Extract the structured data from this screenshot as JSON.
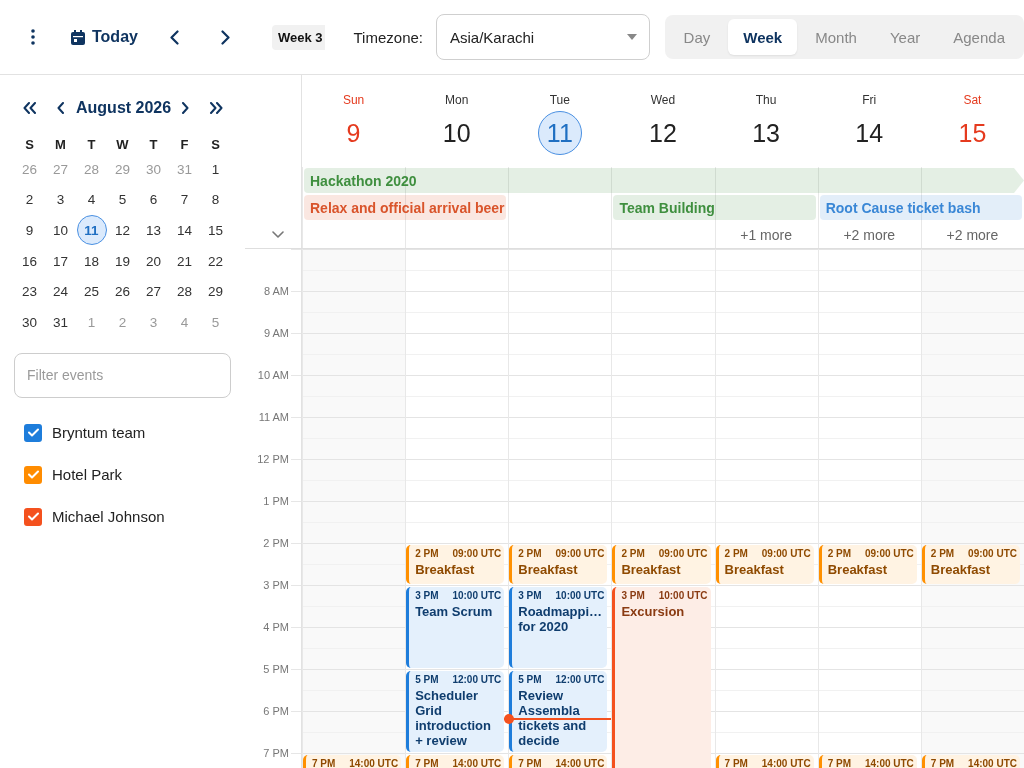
{
  "toolbar": {
    "today": "Today",
    "week_badge": "Week 3",
    "timezone_label": "Timezone:",
    "timezone": "Asia/Karachi",
    "views": [
      {
        "label": "Day",
        "selected": false
      },
      {
        "label": "Week",
        "selected": true
      },
      {
        "label": "Month",
        "selected": false
      },
      {
        "label": "Year",
        "selected": false
      },
      {
        "label": "Agenda",
        "selected": false
      }
    ]
  },
  "sidebar": {
    "month": "August 2026",
    "weekdays": [
      "S",
      "M",
      "T",
      "W",
      "T",
      "F",
      "S"
    ],
    "dates": [
      {
        "day": "26",
        "other_month": true,
        "selected": false
      },
      {
        "day": "27",
        "other_month": true,
        "selected": false
      },
      {
        "day": "28",
        "other_month": true,
        "selected": false
      },
      {
        "day": "29",
        "other_month": true,
        "selected": false
      },
      {
        "day": "30",
        "other_month": true,
        "selected": false
      },
      {
        "day": "31",
        "other_month": true,
        "selected": false
      },
      {
        "day": "1",
        "other_month": false,
        "selected": false
      },
      {
        "day": "2",
        "other_month": false,
        "selected": false
      },
      {
        "day": "3",
        "other_month": false,
        "selected": false
      },
      {
        "day": "4",
        "other_month": false,
        "selected": false
      },
      {
        "day": "5",
        "other_month": false,
        "selected": false
      },
      {
        "day": "6",
        "other_month": false,
        "selected": false
      },
      {
        "day": "7",
        "other_month": false,
        "selected": false
      },
      {
        "day": "8",
        "other_month": false,
        "selected": false
      },
      {
        "day": "9",
        "other_month": false,
        "selected": false
      },
      {
        "day": "10",
        "other_month": false,
        "selected": false
      },
      {
        "day": "11",
        "other_month": false,
        "selected": true
      },
      {
        "day": "12",
        "other_month": false,
        "selected": false
      },
      {
        "day": "13",
        "other_month": false,
        "selected": false
      },
      {
        "day": "14",
        "other_month": false,
        "selected": false
      },
      {
        "day": "15",
        "other_month": false,
        "selected": false
      },
      {
        "day": "16",
        "other_month": false,
        "selected": false
      },
      {
        "day": "17",
        "other_month": false,
        "selected": false
      },
      {
        "day": "18",
        "other_month": false,
        "selected": false
      },
      {
        "day": "19",
        "other_month": false,
        "selected": false
      },
      {
        "day": "20",
        "other_month": false,
        "selected": false
      },
      {
        "day": "21",
        "other_month": false,
        "selected": false
      },
      {
        "day": "22",
        "other_month": false,
        "selected": false
      },
      {
        "day": "23",
        "other_month": false,
        "selected": false
      },
      {
        "day": "24",
        "other_month": false,
        "selected": false
      },
      {
        "day": "25",
        "other_month": false,
        "selected": false
      },
      {
        "day": "26",
        "other_month": false,
        "selected": false
      },
      {
        "day": "27",
        "other_month": false,
        "selected": false
      },
      {
        "day": "28",
        "other_month": false,
        "selected": false
      },
      {
        "day": "29",
        "other_month": false,
        "selected": false
      },
      {
        "day": "30",
        "other_month": false,
        "selected": false
      },
      {
        "day": "31",
        "other_month": false,
        "selected": false
      },
      {
        "day": "1",
        "other_month": true,
        "selected": false
      },
      {
        "day": "2",
        "other_month": true,
        "selected": false
      },
      {
        "day": "3",
        "other_month": true,
        "selected": false
      },
      {
        "day": "4",
        "other_month": true,
        "selected": false
      },
      {
        "day": "5",
        "other_month": true,
        "selected": false
      }
    ],
    "filter": {
      "placeholder": "Filter events"
    },
    "calendars": [
      {
        "name": "Bryntum team",
        "checked": true,
        "color": "#1e7ddb"
      },
      {
        "name": "Hotel Park",
        "checked": true,
        "color": "#ff8c00"
      },
      {
        "name": "Michael Johnson",
        "checked": true,
        "color": "#f4511e"
      }
    ]
  },
  "week": {
    "days": [
      {
        "name": "Sun",
        "date": "9",
        "weekend": true,
        "today": false
      },
      {
        "name": "Mon",
        "date": "10",
        "weekend": false,
        "today": false
      },
      {
        "name": "Tue",
        "date": "11",
        "weekend": false,
        "today": true
      },
      {
        "name": "Wed",
        "date": "12",
        "weekend": false,
        "today": false
      },
      {
        "name": "Thu",
        "date": "13",
        "weekend": false,
        "today": false,
        "more": "+1 more"
      },
      {
        "name": "Fri",
        "date": "14",
        "weekend": false,
        "today": false,
        "more": "+2 more"
      },
      {
        "name": "Sat",
        "date": "15",
        "weekend": true,
        "today": false,
        "more": "+2 more"
      }
    ],
    "all_day_rows": [
      [
        {
          "title": "Hackathon 2020",
          "color": "#3f8f3f",
          "covers": [
            true,
            true,
            true,
            true,
            true,
            true,
            true
          ],
          "continues": true
        }
      ],
      [
        {
          "title": "Relax and official arrival beer",
          "color": "#d9542b",
          "covers": [
            true,
            true,
            false,
            false,
            false,
            false,
            false
          ],
          "continues": false
        },
        {
          "title": "Team Building",
          "color": "#3f8f3f",
          "covers": [
            false,
            false,
            false,
            true,
            true,
            false,
            false
          ],
          "continues": false
        },
        {
          "title": "Root Cause ticket bash",
          "color": "#3a87d6",
          "covers": [
            false,
            false,
            false,
            false,
            false,
            true,
            true
          ],
          "continues": false
        }
      ]
    ],
    "hours": [
      "8 AM",
      "9 AM",
      "10 AM",
      "11 AM",
      "12 PM",
      "1 PM",
      "2 PM",
      "3 PM",
      "4 PM",
      "5 PM",
      "6 PM",
      "7 PM"
    ],
    "events": [
      [
        {
          "kind": "meal",
          "time": "7 PM",
          "utc": "14:00 UTC"
        }
      ],
      [
        {
          "kind": "meal",
          "time": "2 PM",
          "utc": "09:00 UTC",
          "title": "Breakfast"
        },
        {
          "kind": "meeting",
          "time": "3 PM",
          "utc": "10:00 UTC",
          "title": "Team Scrum"
        },
        {
          "kind": "meeting",
          "time": "5 PM",
          "utc": "12:00 UTC",
          "title": "Scheduler Grid introduction + review"
        },
        {
          "kind": "meal",
          "time": "7 PM",
          "utc": "14:00 UTC"
        }
      ],
      [
        {
          "kind": "meal",
          "time": "2 PM",
          "utc": "09:00 UTC",
          "title": "Breakfast"
        },
        {
          "kind": "meeting",
          "time": "3 PM",
          "utc": "10:00 UTC",
          "title": "Roadmappi… for 2020"
        },
        {
          "kind": "meeting",
          "time": "5 PM",
          "utc": "12:00 UTC",
          "title": "Review Assembla tickets and decide"
        },
        {
          "kind": "meal",
          "time": "7 PM",
          "utc": "14:00 UTC"
        }
      ],
      [
        {
          "kind": "meal",
          "time": "2 PM",
          "utc": "09:00 UTC",
          "title": "Breakfast"
        },
        {
          "kind": "excursion",
          "time": "3 PM",
          "utc": "10:00 UTC",
          "title": "Excursion"
        }
      ],
      [
        {
          "kind": "meal",
          "time": "2 PM",
          "utc": "09:00 UTC",
          "title": "Breakfast"
        },
        {
          "kind": "meal",
          "time": "7 PM",
          "utc": "14:00 UTC"
        }
      ],
      [
        {
          "kind": "meal",
          "time": "2 PM",
          "utc": "09:00 UTC",
          "title": "Breakfast"
        },
        {
          "kind": "meal",
          "time": "7 PM",
          "utc": "14:00 UTC"
        }
      ],
      [
        {
          "kind": "meal",
          "time": "2 PM",
          "utc": "09:00 UTC",
          "title": "Breakfast"
        },
        {
          "kind": "meal",
          "time": "7 PM",
          "utc": "14:00 UTC"
        }
      ]
    ]
  }
}
